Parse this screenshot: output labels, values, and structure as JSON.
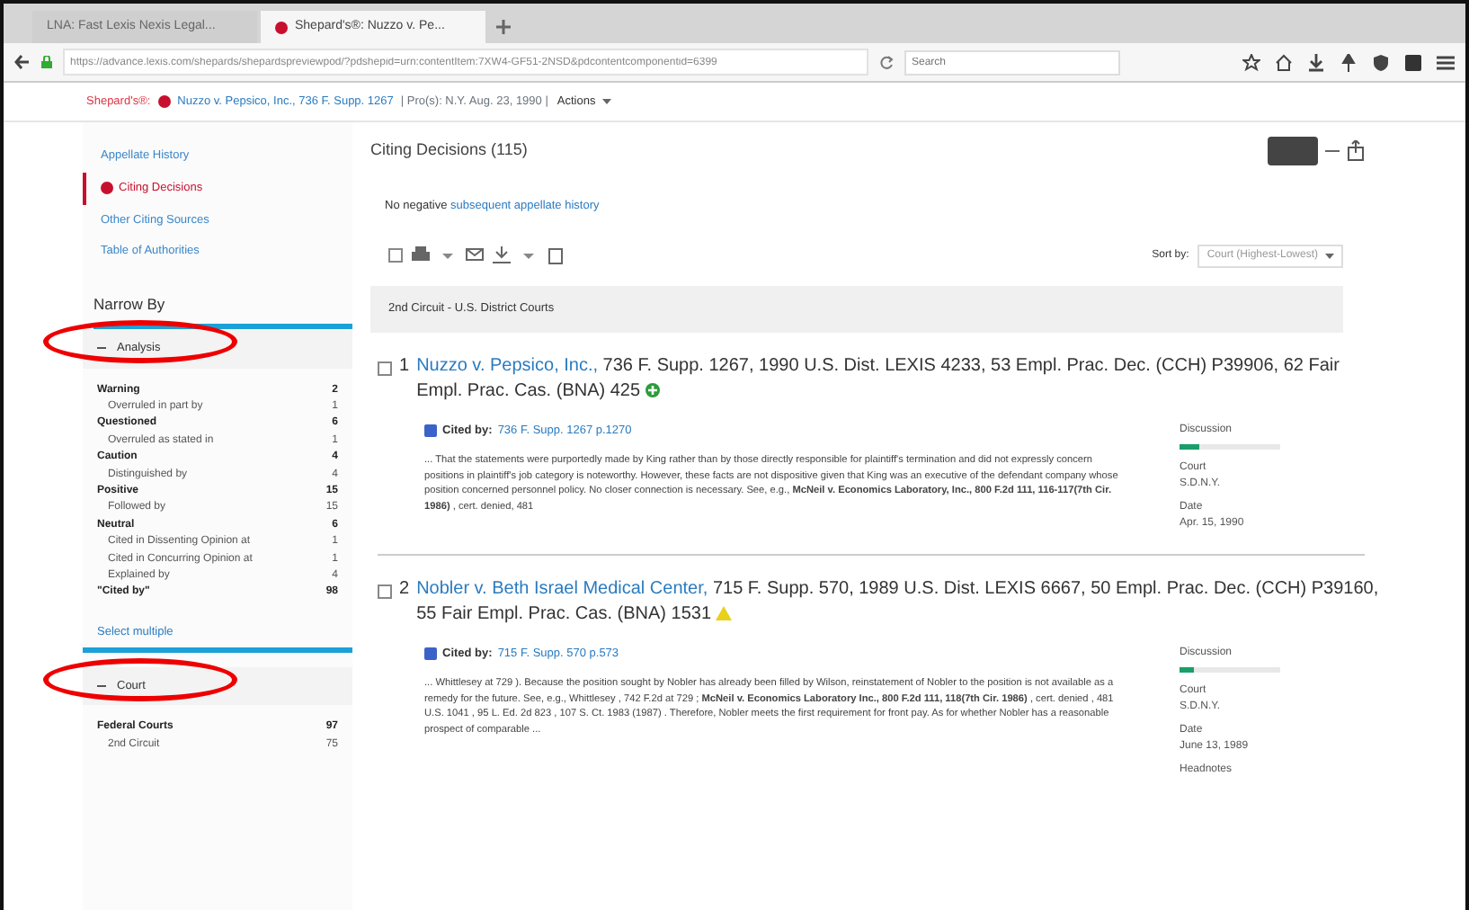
{
  "browser": {
    "tabs": [
      {
        "label": "LNA: Fast Lexis Nexis Legal...",
        "selected": false
      },
      {
        "label": "Shepard's®: Nuzzo v. Pe...",
        "selected": true
      }
    ],
    "address": "https://advance.lexis.com/shepards/shepardspreviewpod/?pdshepid=urn:contentItem:7XW4-GF51-2NSD&pdcontentcomponentid=6399",
    "search_placeholder": "Search"
  },
  "report_header": {
    "label": "Shepard's®:",
    "citation_link": "Nuzzo v. Pepsico, Inc., 736 F. Supp. 1267",
    "details": "| Pro(s): N.Y. Aug. 23, 1990 |",
    "actions": "Actions"
  },
  "sidebar": {
    "nav": [
      {
        "label": "Appellate History",
        "selected": false
      },
      {
        "label": "Citing Decisions",
        "selected": true
      },
      {
        "label": "Other Citing Sources",
        "selected": false
      },
      {
        "label": "Table of Authorities",
        "selected": false
      }
    ],
    "narrow_by": "Narrow By",
    "filters": [
      {
        "label": "Analysis",
        "expanded": true,
        "circled": true,
        "items": [
          {
            "kind": "group",
            "label": "Warning",
            "count": "2"
          },
          {
            "kind": "sub",
            "label": "Overruled in part by",
            "count": "1"
          },
          {
            "kind": "group",
            "label": "Questioned",
            "count": "6"
          },
          {
            "kind": "sub",
            "label": "Overruled as stated in",
            "count": "1"
          },
          {
            "kind": "group",
            "label": "Caution",
            "count": "4"
          },
          {
            "kind": "sub",
            "label": "Distinguished by",
            "count": "4"
          },
          {
            "kind": "group",
            "label": "Positive",
            "count": "15"
          },
          {
            "kind": "sub",
            "label": "Followed by",
            "count": "15"
          },
          {
            "kind": "group",
            "label": "Neutral",
            "count": "6"
          },
          {
            "kind": "sub",
            "label": "Cited in Dissenting Opinion at",
            "count": "1"
          },
          {
            "kind": "sub",
            "label": "Cited in Concurring Opinion at",
            "count": "1"
          },
          {
            "kind": "sub",
            "label": "Explained by",
            "count": "4"
          },
          {
            "kind": "group",
            "label": "\"Cited by\"",
            "count": "98"
          }
        ],
        "link": "Select multiple"
      },
      {
        "label": "Court",
        "expanded": true,
        "circled": true,
        "items": [
          {
            "kind": "group",
            "label": "Federal Courts",
            "count": "97"
          },
          {
            "kind": "sub",
            "label": "2nd Circuit",
            "count": "75"
          }
        ]
      }
    ]
  },
  "main": {
    "title": "Citing Decisions (115)",
    "select_all_checked": false,
    "notice": "No negative",
    "notice_link": "subsequent appellate history",
    "sort_label": "Sort by:",
    "sort_value": "Court (Highest-Lowest)",
    "group": "2nd Circuit - U.S. District Courts",
    "results": [
      {
        "checked": false,
        "number": "1",
        "case_link": "Nuzzo v. Pepsico, Inc.,",
        "citation": "736 F. Supp. 1267, 1990 U.S. Dist. LEXIS 4233, 53 Empl. Prac. Dec. (CCH) P39906, 62 Fair Empl. Prac. Cas. (BNA) 425",
        "kind": "positive",
        "cited_by_label": "Cited by:",
        "cited_by_link": "736 F. Supp. 1267 p.1270",
        "passage": "... That the statements were purportedly made by King rather than by those directly responsible for plaintiff's termination and did not expressly concern positions in plaintiff's job category is noteworthy. However, these facts are not dispositive given that King was an executive of the defendant company whose position concerned personnel policy. No closer connection is necessary. See, e.g., **McNeil v. Economics Laboratory, Inc., 800 F.2d 111, 116-117(7th Cir. 1986)** , cert. denied, 481",
        "discussion_label": "Discussion",
        "level": 0.2,
        "court_label": "Court",
        "court": "S.D.N.Y.",
        "date_label": "Date",
        "date": "Apr. 15, 1990"
      },
      {
        "checked": false,
        "number": "2",
        "case_link": "Nobler v. Beth Israel Medical Center,",
        "citation": "715 F. Supp. 570, 1989 U.S. Dist. LEXIS 6667, 50 Empl. Prac. Dec. (CCH) P39160, 55 Fair Empl. Prac. Cas. (BNA) 1531",
        "kind": "caution",
        "cited_by_label": "Cited by:",
        "cited_by_link": "715 F. Supp. 570 p.573",
        "passage": "... Whittlesey at 729 ). Because the position sought by Nobler has already been filled by Wilson, reinstatement of Nobler to the position is not available as a remedy for the future. See, e.g., Whittlesey , 742 F.2d at 729 ; **McNeil v. Economics Laboratory Inc., 800 F.2d 111, 118(7th Cir. 1986)** , cert. denied , 481 U.S. 1041 , 95 L. Ed. 2d 823 , 107 S. Ct. 1983 (1987) . Therefore, Nobler meets the first requirement for front pay. As for whether Nobler has a reasonable prospect of comparable ...",
        "discussion_label": "Discussion",
        "level": 0.15,
        "court_label": "Court",
        "court": "S.D.N.Y.",
        "date_label": "Date",
        "date": "June 13, 1989",
        "extra": "Headnotes"
      }
    ]
  }
}
